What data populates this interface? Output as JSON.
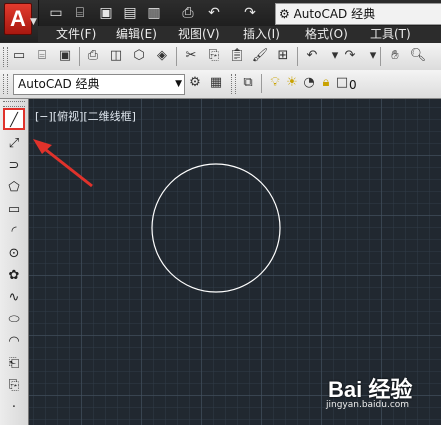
{
  "title_bar": {
    "workspace_label": "AutoCAD 经典",
    "quick_access": [
      "new-icon",
      "open-icon",
      "save-icon",
      "saveas-icon",
      "publish-icon",
      "print-icon",
      "undo-icon",
      "redo-icon"
    ]
  },
  "menu_bar": {
    "items": [
      "文件(F)",
      "编辑(E)",
      "视图(V)",
      "插入(I)",
      "格式(O)",
      "工具(T)"
    ]
  },
  "toolbar2": {
    "workspace_select": "AutoCAD 经典",
    "layer_value": "0"
  },
  "palette": {
    "tools": [
      "line-icon",
      "construction-line-icon",
      "polyline-icon",
      "polygon-icon",
      "rectangle-icon",
      "arc-icon",
      "circle-icon",
      "revcloud-icon",
      "spline-icon",
      "ellipse-icon",
      "ellipse-arc-icon",
      "insert-block-icon",
      "make-block-icon",
      "point-icon"
    ],
    "selected": "line-icon"
  },
  "canvas": {
    "viewport_label": "[−][俯视][二维线框]"
  },
  "watermark": {
    "logo": "Bai 经验",
    "url": "jingyan.baidu.com"
  },
  "colors": {
    "canvas_bg": "#212830",
    "annotation_red": "#e0322b"
  }
}
